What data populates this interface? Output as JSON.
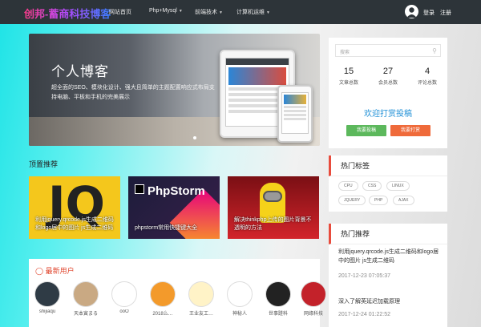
{
  "header": {
    "logo": "创邦-蓄商科技博客",
    "nav": [
      {
        "label": "网站首页",
        "caret": ""
      },
      {
        "label": "Php+Mysql",
        "caret": "▼"
      },
      {
        "label": "前端技术",
        "caret": "▼"
      },
      {
        "label": "计算机运维",
        "caret": "▼"
      }
    ],
    "login": "登录",
    "register": "注册"
  },
  "banner": {
    "title": "个人博客",
    "text": "超全面的SEO、模块化设计、强大且简单的主题配置响应式布局支持电脑、平板和手机的完美展示"
  },
  "featured": {
    "title": "顶置推荐",
    "cards": [
      {
        "logo": "JQ",
        "caption": "利用jquery.qrcode.js生成二维码和logo居中的图片 js生成二维码"
      },
      {
        "logo": "PhpStorm",
        "caption": "phpstorm常用快捷键大全"
      },
      {
        "logo": "",
        "caption": "解决thinkphp上传的图片背景不透明的方法"
      }
    ]
  },
  "users": {
    "title": "最新用户",
    "list": [
      {
        "name": "shijiaqu",
        "color": "#2f3b45"
      },
      {
        "name": "天本寅まる",
        "color": "#c9a983"
      },
      {
        "name": "ooO",
        "color": "#ffffff"
      },
      {
        "name": "2018么…",
        "color": "#f39a2b"
      },
      {
        "name": "王业友工…",
        "color": "#fff3c7"
      },
      {
        "name": "神秘人",
        "color": "#ffffff"
      },
      {
        "name": "世事蹉科",
        "color": "#222222"
      },
      {
        "name": "网缘科技",
        "color": "#c3222a"
      }
    ]
  },
  "sidebar": {
    "search_placeholder": "搜索",
    "stats": [
      {
        "value": "15",
        "label": "文章总数"
      },
      {
        "value": "27",
        "label": "会员总数"
      },
      {
        "value": "4",
        "label": "评论总数"
      }
    ],
    "welcome": "欢迎打赏投稿",
    "contribute": "我要投稿",
    "donate": "我要打赏",
    "tags_title": "热门标签",
    "tags": [
      "CPU",
      "CSS",
      "LINUX",
      "JQUERY",
      "PHP",
      "AJAX"
    ],
    "hot_title": "热门推荐",
    "hot": [
      {
        "title": "利用jquery.qrcode.js生成二维码和logo居中的图片 js生成二维码",
        "date": "2017-12-23 07:05:37"
      },
      {
        "title": "深入了解英延迟加载原理",
        "date": "2017-12-24 01:22:52"
      }
    ]
  },
  "colors": {
    "accent": "#e84c3d",
    "header_bg": "#2d3439",
    "link_blue": "#1e8fd6"
  }
}
